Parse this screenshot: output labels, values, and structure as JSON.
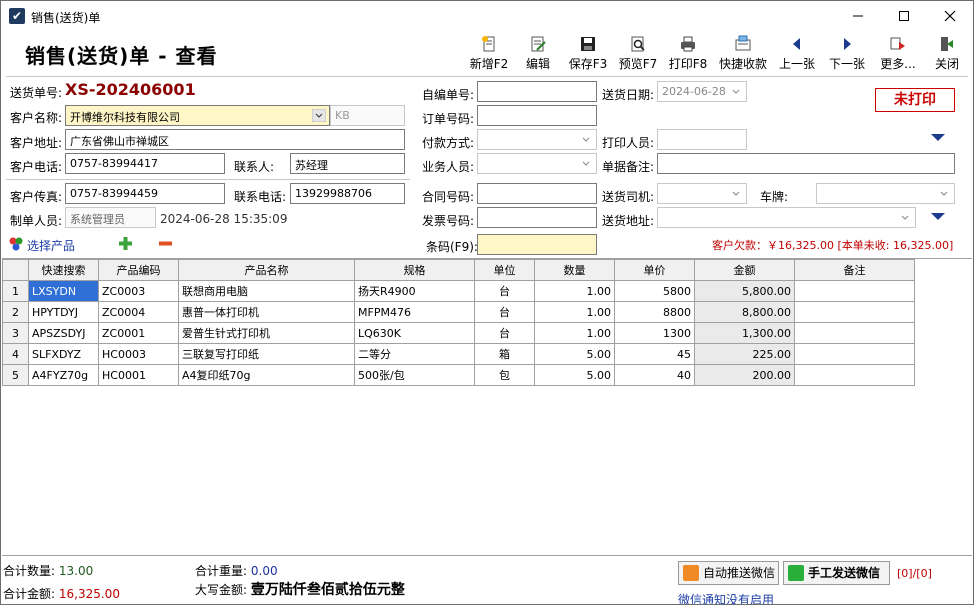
{
  "window": {
    "title": "销售(送货)单"
  },
  "header": {
    "form_title": "销售(送货)单  -  查看"
  },
  "toolbar": [
    {
      "label": "新增F2",
      "icon": "new-doc-icon"
    },
    {
      "label": "编辑",
      "icon": "edit-icon"
    },
    {
      "label": "保存F3",
      "icon": "save-icon"
    },
    {
      "label": "预览F7",
      "icon": "preview-icon"
    },
    {
      "label": "打印F8",
      "icon": "print-icon"
    },
    {
      "label": "快捷收款",
      "icon": "receive-payment-icon"
    },
    {
      "label": "上一张",
      "icon": "arrow-left-icon"
    },
    {
      "label": "下一张",
      "icon": "arrow-right-icon"
    },
    {
      "label": "更多...",
      "icon": "more-icon"
    },
    {
      "label": "关闭",
      "icon": "exit-icon"
    }
  ],
  "form": {
    "order_no_label": "送货单号:",
    "order_no": "XS-202406001",
    "customer_name_label": "客户名称:",
    "customer_name": "开博维尔科技有限公司",
    "kb_placeholder": "KB",
    "customer_address_label": "客户地址:",
    "customer_address": "广东省佛山市禅城区",
    "customer_phone_label": "客户电话:",
    "customer_phone": "0757-83994417",
    "contact_label": "联系人:",
    "contact": "苏经理",
    "customer_fax_label": "客户传真:",
    "customer_fax": "0757-83994459",
    "contact_phone_label": "联系电话:",
    "contact_phone": "13929988706",
    "maker_label": "制单人员:",
    "maker": "系统管理员",
    "make_time": "2024-06-28 15:35:09",
    "self_no_label": "自编单号:",
    "self_no": "",
    "ref_no_label": "订单号码:",
    "ref_no": "",
    "pay_method_label": "付款方式:",
    "pay_method": "",
    "salesman_label": "业务人员:",
    "salesman": "",
    "contract_no_label": "合同号码:",
    "contract_no": "",
    "invoice_no_label": "发票号码:",
    "invoice_no": "",
    "barcode_label": "条码(F9):",
    "barcode": "",
    "delivery_date_label": "送货日期:",
    "delivery_date": "2024-06-28",
    "printer_label": "打印人员:",
    "printer": "",
    "remark_label": "单据备注:",
    "remark": "",
    "driver_label": "送货司机:",
    "driver": "",
    "plate_label": "车牌:",
    "plate": "",
    "delivery_addr_label": "送货地址:",
    "delivery_addr": "",
    "print_status": "未打印"
  },
  "products_bar": {
    "choose_label": "选择产品",
    "owe_text": "客户欠款：￥16,325.00  [本单未收: 16,325.00]"
  },
  "grid": {
    "columns": [
      "快速搜索",
      "产品编码",
      "产品名称",
      "规格",
      "单位",
      "数量",
      "单价",
      "金额",
      "备注"
    ],
    "rows": [
      {
        "rn": "1",
        "search": "LXSYDN",
        "code": "ZC0003",
        "name": "联想商用电脑",
        "spec": "扬天R4900",
        "unit": "台",
        "qty": "1.00",
        "price": "5800",
        "amount": "5,800.00",
        "note": ""
      },
      {
        "rn": "2",
        "search": "HPYTDYJ",
        "code": "ZC0004",
        "name": "惠普一体打印机",
        "spec": "MFPM476",
        "unit": "台",
        "qty": "1.00",
        "price": "8800",
        "amount": "8,800.00",
        "note": ""
      },
      {
        "rn": "3",
        "search": "APSZSDYJ",
        "code": "ZC0001",
        "name": "爱普生针式打印机",
        "spec": "LQ630K",
        "unit": "台",
        "qty": "1.00",
        "price": "1300",
        "amount": "1,300.00",
        "note": ""
      },
      {
        "rn": "4",
        "search": "SLFXDYZ",
        "code": "HC0003",
        "name": "三联复写打印纸",
        "spec": "二等分",
        "unit": "箱",
        "qty": "5.00",
        "price": "45",
        "amount": "225.00",
        "note": ""
      },
      {
        "rn": "5",
        "search": "A4FYZ70g",
        "code": "HC0001",
        "name": "A4复印纸70g",
        "spec": "500张/包",
        "unit": "包",
        "qty": "5.00",
        "price": "40",
        "amount": "200.00",
        "note": ""
      }
    ]
  },
  "footer": {
    "total_qty_label": "合计数量:",
    "total_qty": "13.00",
    "total_weight_label": "合计重量:",
    "total_weight": "0.00",
    "total_amount_label": "合计金额:",
    "total_amount": "16,325.00",
    "capital_label": "大写金额:",
    "capital_amount": "壹万陆仟叁佰贰拾伍元整",
    "auto_wechat": "自动推送微信",
    "manual_wechat": "手工发送微信",
    "count_tag": "[0]/[0]",
    "wechat_note": "微信通知没有启用"
  }
}
